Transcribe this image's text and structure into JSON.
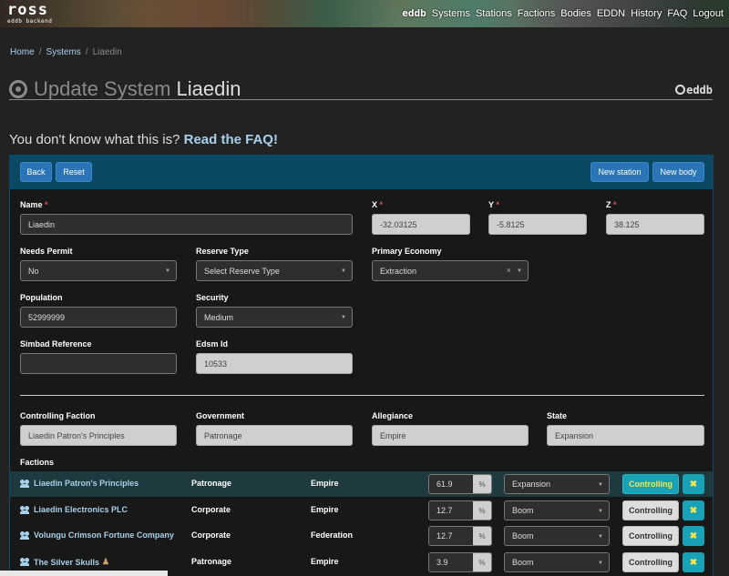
{
  "nav": {
    "logo": "ross",
    "logo_sub": "eddb backend",
    "brand": "eddb",
    "items": [
      "Systems",
      "Stations",
      "Factions",
      "Bodies",
      "EDDN",
      "History",
      "FAQ",
      "Logout"
    ]
  },
  "breadcrumb": {
    "home": "Home",
    "sep": "/",
    "systems": "Systems",
    "current": "Liaedin"
  },
  "page": {
    "title_prefix": "Update System",
    "title_name": "Liaedin",
    "brand": "eddb"
  },
  "faq": {
    "text": "You don't know what this is?",
    "link": "Read the FAQ!"
  },
  "actions": {
    "back": "Back",
    "reset": "Reset",
    "new_station": "New station",
    "new_body": "New body"
  },
  "form": {
    "name_label": "Name",
    "name_value": "Liaedin",
    "required_mark": "*",
    "x_label": "X",
    "x_value": "-32.03125",
    "y_label": "Y",
    "y_value": "-5.8125",
    "z_label": "Z",
    "z_value": "38.125",
    "permit_label": "Needs Permit",
    "permit_value": "No",
    "reserve_label": "Reserve Type",
    "reserve_placeholder": "Select Reserve Type",
    "economy_label": "Primary Economy",
    "economy_value": "Extraction",
    "population_label": "Population",
    "population_value": "52999999",
    "security_label": "Security",
    "security_value": "Medium",
    "simbad_label": "Simbad Reference",
    "simbad_value": "",
    "edsm_label": "Edsm Id",
    "edsm_value": "10533",
    "controlling_label": "Controlling Faction",
    "controlling_value": "Liaedin Patron's Principles",
    "government_label": "Government",
    "government_value": "Patronage",
    "allegiance_label": "Allegiance",
    "allegiance_value": "Empire",
    "state_label": "State",
    "state_value": "Expansion"
  },
  "factions": {
    "label": "Factions",
    "unit": "%",
    "controlling_label": "Controlling",
    "remove_glyph": "✖",
    "rows": [
      {
        "name": "Liaedin Patron's Principles",
        "government": "Patronage",
        "allegiance": "Empire",
        "influence": "61.9",
        "state": "Expansion",
        "controlling": true
      },
      {
        "name": "Liaedin Electronics PLC",
        "government": "Corporate",
        "allegiance": "Empire",
        "influence": "12.7",
        "state": "Boom",
        "controlling": false
      },
      {
        "name": "Volungu Crimson Fortune Company",
        "government": "Corporate",
        "allegiance": "Federation",
        "influence": "12.7",
        "state": "Boom",
        "controlling": false
      },
      {
        "name": "The Silver Skulls",
        "government": "Patronage",
        "allegiance": "Empire",
        "influence": "3.9",
        "state": "Boom",
        "controlling": false
      }
    ]
  }
}
